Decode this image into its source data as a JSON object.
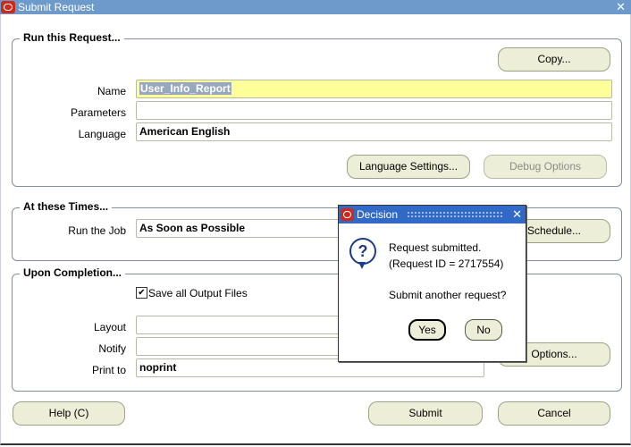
{
  "window": {
    "title": "Submit Request",
    "close_glyph": "✕"
  },
  "run_section": {
    "title": "Run this Request...",
    "copy_button": "Copy...",
    "name_label": "Name",
    "name_value": "User_Info_Report",
    "parameters_label": "Parameters",
    "parameters_value": "",
    "language_label": "Language",
    "language_value": "American English",
    "language_settings_button": "Language Settings...",
    "debug_options_button": "Debug Options"
  },
  "times_section": {
    "title": "At these Times...",
    "run_job_label": "Run the Job",
    "run_job_value": "As Soon as Possible",
    "schedule_button": "Schedule..."
  },
  "completion_section": {
    "title": "Upon Completion...",
    "save_output_label": "Save all Output Files",
    "save_output_checked": "✔",
    "layout_label": "Layout",
    "notify_label": "Notify",
    "print_to_label": "Print to",
    "print_to_value": "noprint",
    "options_button": "Options..."
  },
  "footer": {
    "help_button": "Help (C)",
    "submit_button": "Submit",
    "cancel_button": "Cancel"
  },
  "dialog": {
    "title": "Decision",
    "close_glyph": "✕",
    "icon_glyph": "?",
    "line1": "Request submitted.",
    "line2": "(Request ID = 2717554)",
    "question": "Submit another request?",
    "yes_button": "Yes",
    "no_button": "No"
  }
}
